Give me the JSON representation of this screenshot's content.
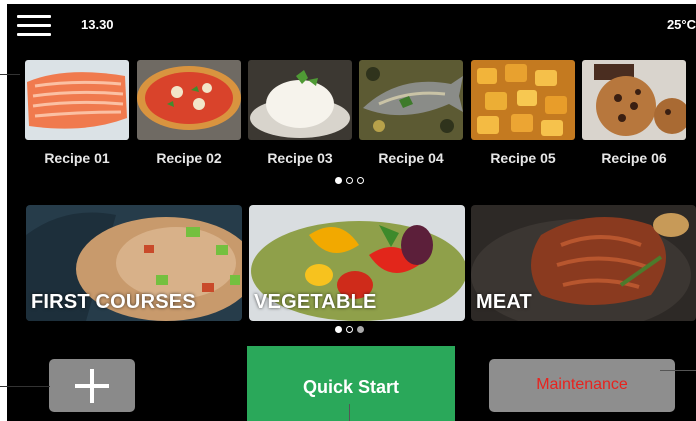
{
  "header": {
    "time": "13.30",
    "temperature": "25°C"
  },
  "recipes": [
    {
      "label": "Recipe 01",
      "image": "salmon-fillet"
    },
    {
      "label": "Recipe 02",
      "image": "pizza"
    },
    {
      "label": "Recipe 03",
      "image": "rice"
    },
    {
      "label": "Recipe 04",
      "image": "grilled-fish"
    },
    {
      "label": "Recipe 05",
      "image": "roasted-potatoes"
    },
    {
      "label": "Recipe 06",
      "image": "cookies"
    }
  ],
  "recipe_pager": {
    "pages": 3,
    "current": 1
  },
  "categories": [
    {
      "label": "FIRST COURSES",
      "image": "rice-dish"
    },
    {
      "label": "VEGETABLE",
      "image": "vegetable-salad"
    },
    {
      "label": "MEAT",
      "image": "roast-meat"
    }
  ],
  "category_pager": {
    "pages": 3,
    "current": 1
  },
  "buttons": {
    "add_icon": "plus-icon",
    "quick_start": "Quick Start",
    "maintenance": "Maintenance"
  },
  "colors": {
    "background": "#000000",
    "quick_start": "#2aa85a",
    "buttons_grey": "#8a8a8a",
    "maintenance_text": "#e8231e"
  }
}
